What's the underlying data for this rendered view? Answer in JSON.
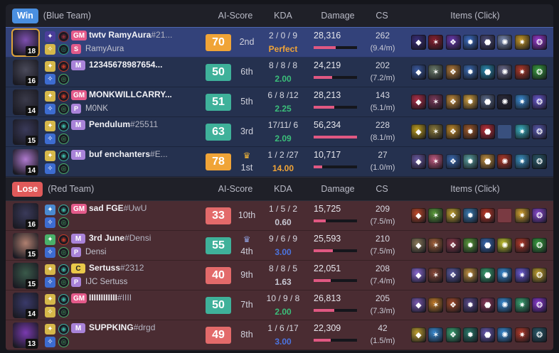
{
  "headers": {
    "ai_score": "AI-Score",
    "kda": "KDA",
    "damage": "Damage",
    "cs": "CS",
    "items": "Items (Click)"
  },
  "teams": [
    {
      "result": "Win",
      "team": "(Blue Team)",
      "side": "blue",
      "players": [
        {
          "level": "18",
          "tag": "GM",
          "name": "twtv RamyAura",
          "tagline": "#21...",
          "sub_icon": "S",
          "sub": "RamyAura",
          "score": "70",
          "rank": "2nd",
          "kda": "2 / 0 / 9",
          "kda_ratio": "Perfect",
          "damage": "28,316",
          "dmg_pct": 0.5,
          "cs": "262",
          "csm": "(9.4/m)",
          "colors": [
            "#7e4fb0",
            "#4a3d9a",
            "#d6b84a",
            "#8a2d3a",
            "#2b9a7a",
            "#6a5acd"
          ],
          "items": [
            "#3a2e7a",
            "#8a2030",
            "#6a3ab0",
            "#3b6cc0",
            "#4c4c7a",
            "#7a8ab0",
            "#c89a28",
            "#9a3ad0"
          ],
          "highlight": true,
          "gold": true
        },
        {
          "level": "16",
          "tag": "M",
          "name": "12345678987654...",
          "tagline": "",
          "sub_icon": "",
          "sub": "",
          "score": "50",
          "rank": "6th",
          "kda": "8 / 8 / 8",
          "kda_ratio": "2.00",
          "damage": "24,219",
          "dmg_pct": 0.43,
          "cs": "202",
          "csm": "(7.2/m)",
          "colors": [
            "#4a4a5a",
            "#d6b84a",
            "#3d6cd0",
            "#c03a2a",
            "#4ab06a",
            "#c45a30"
          ],
          "items": [
            "#3a5aa0",
            "#6a7a6a",
            "#b07a3a",
            "#3a6ab0",
            "#2a8ab0",
            "#6a6a8a",
            "#b03a2a",
            "#3aa040"
          ],
          "highlight": false,
          "gold": false
        },
        {
          "level": "14",
          "tag": "GM",
          "name": "MONKWILLCARRY...",
          "tagline": "",
          "sub_icon": "P",
          "sub": "M0NK",
          "score": "51",
          "rank": "5th",
          "kda": "6 / 8 /12",
          "kda_ratio": "2.25",
          "damage": "28,213",
          "dmg_pct": 0.48,
          "cs": "143",
          "csm": "(5.1/m)",
          "colors": [
            "#3a3a4a",
            "#d6b84a",
            "#3d6cd0",
            "#c03a2a",
            "#4ab06a",
            "#c45a30"
          ],
          "items": [
            "#b0304a",
            "#7a3a5a",
            "#c08a3a",
            "#d0a040",
            "#5a6a8a",
            "#2a2a3a",
            "#3a8ad0",
            "#6a5ad0"
          ],
          "highlight": false,
          "gold": false
        },
        {
          "level": "15",
          "tag": "M",
          "name": "Pendulum",
          "tagline": "#25511",
          "sub_icon": "",
          "sub": "",
          "score": "63",
          "rank": "3rd",
          "kda": "17/11/ 6",
          "kda_ratio": "2.09",
          "damage": "56,234",
          "dmg_pct": 1.0,
          "cs": "228",
          "csm": "(8.1/m)",
          "colors": [
            "#3a3a5a",
            "#d6b84a",
            "#3d6cd0",
            "#3ab0a0",
            "#4ab06a",
            "#c45a30"
          ],
          "items": [
            "#c0a020",
            "#8a7a3a",
            "#c08a2a",
            "#a05a2a",
            "#c0303a",
            "",
            "#3ab0c0",
            "#5a5ab0"
          ],
          "highlight": false,
          "gold": false
        },
        {
          "level": "14",
          "tag": "M",
          "name": "buf enchanters",
          "tagline": "#E...",
          "sub_icon": "",
          "sub": "",
          "score": "78",
          "rank": "1st",
          "kda": "1 / 2 /27",
          "kda_ratio": "14.00",
          "damage": "10,717",
          "dmg_pct": 0.19,
          "cs": "27",
          "csm": "(1.0/m)",
          "colors": [
            "#b07ad0",
            "#d6b84a",
            "#3d6cd0",
            "#3ab0a0",
            "#4ab06a",
            "#c45a30"
          ],
          "items": [
            "#6a5aa0",
            "#c05a80",
            "#3a6ab0",
            "#5aa0a0",
            "#c09040",
            "#b03a2a",
            "#3a90c0",
            "#2a5a6a"
          ],
          "highlight": false,
          "gold": false
        }
      ]
    },
    {
      "result": "Lose",
      "team": "(Red Team)",
      "side": "red",
      "players": [
        {
          "level": "16",
          "tag": "GM",
          "name": "sad FGE",
          "tagline": "#UwU",
          "sub_icon": "",
          "sub": "",
          "score": "33",
          "rank": "10th",
          "kda": "1 / 5 / 2",
          "kda_ratio": "0.60",
          "damage": "15,725",
          "dmg_pct": 0.28,
          "cs": "209",
          "csm": "(7.5/m)",
          "colors": [
            "#3a3a5a",
            "#4a8ad0",
            "#3d6cd0",
            "#3ab0a0",
            "#4ab06a",
            "#c45a30"
          ],
          "items": [
            "#c04a2a",
            "#5a9a3a",
            "#c0a030",
            "#3a7ab0",
            "#c03a2a",
            "",
            "#d0a030",
            "#8a4ad0"
          ],
          "highlight": false,
          "gold": false
        },
        {
          "level": "15",
          "tag": "M",
          "name": "3rd June",
          "tagline": "#Densi",
          "sub_icon": "P",
          "sub": "Densi",
          "score": "55",
          "rank": "4th",
          "kda": "9 / 6 / 9",
          "kda_ratio": "3.00",
          "damage": "25,593",
          "dmg_pct": 0.45,
          "cs": "210",
          "csm": "(7.5/m)",
          "colors": [
            "#b08070",
            "#4ab06a",
            "#3d6cd0",
            "#c03a2a",
            "#4ab06a",
            "#c45a30"
          ],
          "items": [
            "#8a7a5a",
            "#a0603a",
            "#8a3a4a",
            "#5a9a3a",
            "#3a6ab0",
            "#c0c030",
            "#b03a2a",
            "#3aa040"
          ],
          "highlight": false,
          "gold": false
        },
        {
          "level": "15",
          "tag": "C",
          "name": "Sertuss",
          "tagline": "#2312",
          "sub_icon": "P",
          "sub": "IJC Sertuss",
          "score": "40",
          "rank": "9th",
          "kda": "8 / 8 / 5",
          "kda_ratio": "1.63",
          "damage": "22,051",
          "dmg_pct": 0.39,
          "cs": "208",
          "csm": "(7.4/m)",
          "colors": [
            "#3a5a4a",
            "#d6b84a",
            "#3d6cd0",
            "#3ab0a0",
            "#4ab06a",
            "#c45a30"
          ],
          "items": [
            "#8a6ad0",
            "#8a4a3a",
            "#5a5aa0",
            "#c09040",
            "#3aa070",
            "#3a8ad0",
            "#6a5ad0",
            "#c0a030"
          ],
          "highlight": false,
          "gold": false
        },
        {
          "level": "14",
          "tag": "GM",
          "name": "IIIIIIIIIIII",
          "tagline": "#IIII",
          "sub_icon": "",
          "sub": "",
          "score": "50",
          "rank": "7th",
          "kda": "10 / 9 / 8",
          "kda_ratio": "2.00",
          "damage": "26,813",
          "dmg_pct": 0.47,
          "cs": "205",
          "csm": "(7.3/m)",
          "colors": [
            "#3a3a6a",
            "#d6b84a",
            "#d6b84a",
            "#3ab0a0",
            "#4ab06a",
            "#c45a30"
          ],
          "items": [
            "#7a5ab0",
            "#c07a2a",
            "#a04a2a",
            "#5a4a8a",
            "#8a3a5a",
            "#3a8ad0",
            "#3aa070",
            "#8a3ad0"
          ],
          "highlight": false,
          "gold": false
        },
        {
          "level": "13",
          "tag": "M",
          "name": "SUPPKING",
          "tagline": "#drgd",
          "sub_icon": "",
          "sub": "",
          "score": "49",
          "rank": "8th",
          "kda": "1 / 6 /17",
          "kda_ratio": "3.00",
          "damage": "22,309",
          "dmg_pct": 0.4,
          "cs": "42",
          "csm": "(1.5/m)",
          "colors": [
            "#7a3ab0",
            "#d6b84a",
            "#3d6cd0",
            "#3ab0a0",
            "#4ab06a",
            "#c45a30"
          ],
          "items": [
            "#c0a030",
            "#3a8ad0",
            "#3aa070",
            "#2a7a6a",
            "#6a5ab0",
            "#3a8ad0",
            "#b03a2a",
            "#2a5a6a"
          ],
          "highlight": false,
          "gold": false
        }
      ]
    }
  ],
  "palette": {
    "score_high": "#f0a437",
    "score_mid": "#3fb19a",
    "score_low": "#e36a6a",
    "kda_green": "#3bbf7a",
    "kda_blue": "#4b74e0",
    "kda_orange": "#f0a437",
    "kda_gray": "#c8c9d4"
  }
}
